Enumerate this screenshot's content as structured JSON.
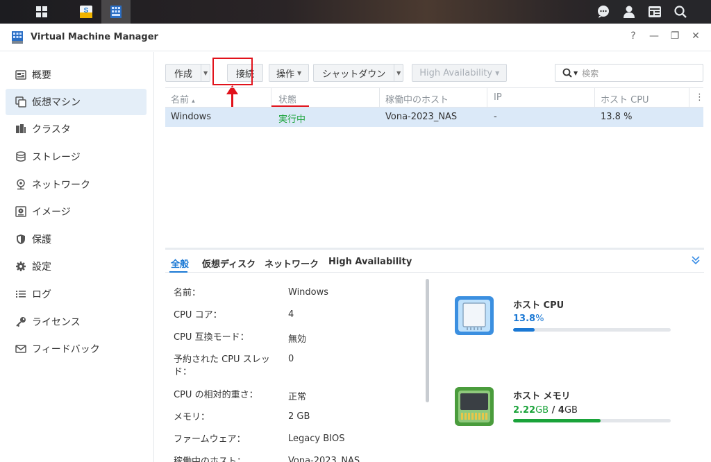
{
  "taskbar": {
    "main_menu_icon": "grid-icon",
    "apps": [
      "package-center-icon",
      "virtual-machine-manager-icon"
    ],
    "right_icons": [
      "chat-icon",
      "user-icon",
      "widgets-icon",
      "search-icon"
    ]
  },
  "window": {
    "title": "Virtual Machine Manager",
    "controls": {
      "help": "?",
      "minimize": "—",
      "restore": "❐",
      "close": "✕"
    }
  },
  "sidebar": {
    "items": [
      {
        "label": "概要",
        "icon": "overview-icon"
      },
      {
        "label": "仮想マシン",
        "icon": "virtual-machine-icon",
        "active": true
      },
      {
        "label": "クラスタ",
        "icon": "cluster-icon"
      },
      {
        "label": "ストレージ",
        "icon": "storage-icon"
      },
      {
        "label": "ネットワーク",
        "icon": "network-icon"
      },
      {
        "label": "イメージ",
        "icon": "image-icon"
      },
      {
        "label": "保護",
        "icon": "shield-icon"
      },
      {
        "label": "設定",
        "icon": "gear-icon"
      },
      {
        "label": "ログ",
        "icon": "list-icon"
      },
      {
        "label": "ライセンス",
        "icon": "key-icon"
      },
      {
        "label": "フィードバック",
        "icon": "mail-icon"
      }
    ]
  },
  "toolbar": {
    "create": "作成",
    "connect": "接続",
    "action": "操作",
    "shutdown": "シャットダウン",
    "high_availability": "High Availability",
    "search_placeholder": "検索"
  },
  "table": {
    "columns": [
      "名前",
      "状態",
      "稼働中のホスト",
      "IP",
      "ホスト CPU"
    ],
    "sort_indicator": "▴",
    "rows": [
      {
        "name": "Windows",
        "status": "実行中",
        "host": "Vona-2023_NAS",
        "ip": "-",
        "host_cpu": "13.8 %"
      }
    ]
  },
  "details": {
    "tabs": [
      "全般",
      "仮想ディスク",
      "ネットワーク",
      "High Availability"
    ],
    "fields": [
      {
        "label": "名前：",
        "value": "Windows"
      },
      {
        "label": "CPU コア：",
        "value": "4"
      },
      {
        "label": "CPU 互換モード：",
        "value": "無効"
      },
      {
        "label": "予約された CPU スレッド：",
        "value": "0"
      },
      {
        "label": "CPU の相対的重さ：",
        "value": "正常"
      },
      {
        "label": "メモリ：",
        "value": "2 GB"
      },
      {
        "label": "ファームウェア：",
        "value": "Legacy BIOS"
      },
      {
        "label": "稼働中のホスト：",
        "value": "Vona-2023_NAS"
      }
    ],
    "resources": {
      "cpu": {
        "title": "ホスト CPU",
        "value": "13.8",
        "unit": "%",
        "percent": 13.8,
        "color": "#1a78d4"
      },
      "memory": {
        "title": "ホスト メモリ",
        "used": "2.22",
        "used_unit": "GB",
        "sep": "/",
        "total": "4",
        "total_unit": "GB",
        "percent": 55.5,
        "color": "#1aa33a"
      }
    }
  },
  "colors": {
    "accent": "#1a78d4",
    "running": "#1aa33a",
    "highlight": "#e1121b",
    "selected_row": "#dbe9f8"
  }
}
